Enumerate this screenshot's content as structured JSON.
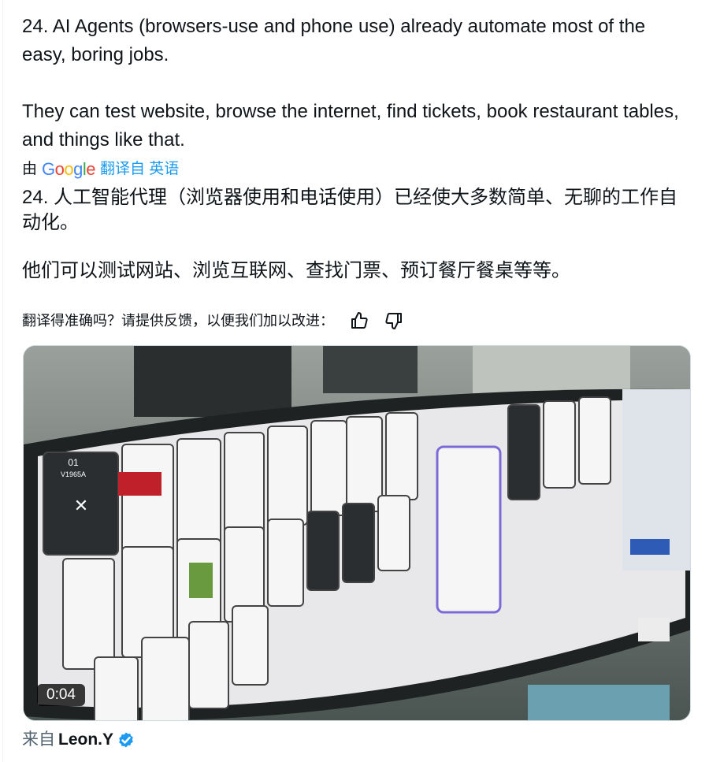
{
  "tweet": {
    "original_p1": "24. AI Agents (browsers-use and phone use) already automate most of the easy, boring jobs.",
    "original_p2": "They can test website, browse the internet, find tickets, book restaurant tables, and things like that.",
    "translation_by": "由",
    "translation_brand": "Google",
    "translation_from": "翻译自 英语",
    "translated_p1": "24. 人工智能代理（浏览器使用和电话使用）已经使大多数简单、无聊的工作自动化。",
    "translated_p2": "他们可以测试网站、浏览互联网、查找门票、预订餐厅餐桌等等。",
    "feedback_prompt": "翻译得准确吗？请提供反馈，以便我们加以改进：",
    "feedback_icons": [
      "thumbs-up-icon",
      "thumbs-down-icon"
    ]
  },
  "video": {
    "duration": "0:04",
    "screen_label_1": "01",
    "screen_label_2": "V1965A"
  },
  "source": {
    "label": "来自",
    "author": "Leon.Y",
    "verified": true,
    "verified_color": "#1d9bf0"
  },
  "colors": {
    "link": "#1d9bf0",
    "text": "#0f1419",
    "secondary": "#536471"
  }
}
